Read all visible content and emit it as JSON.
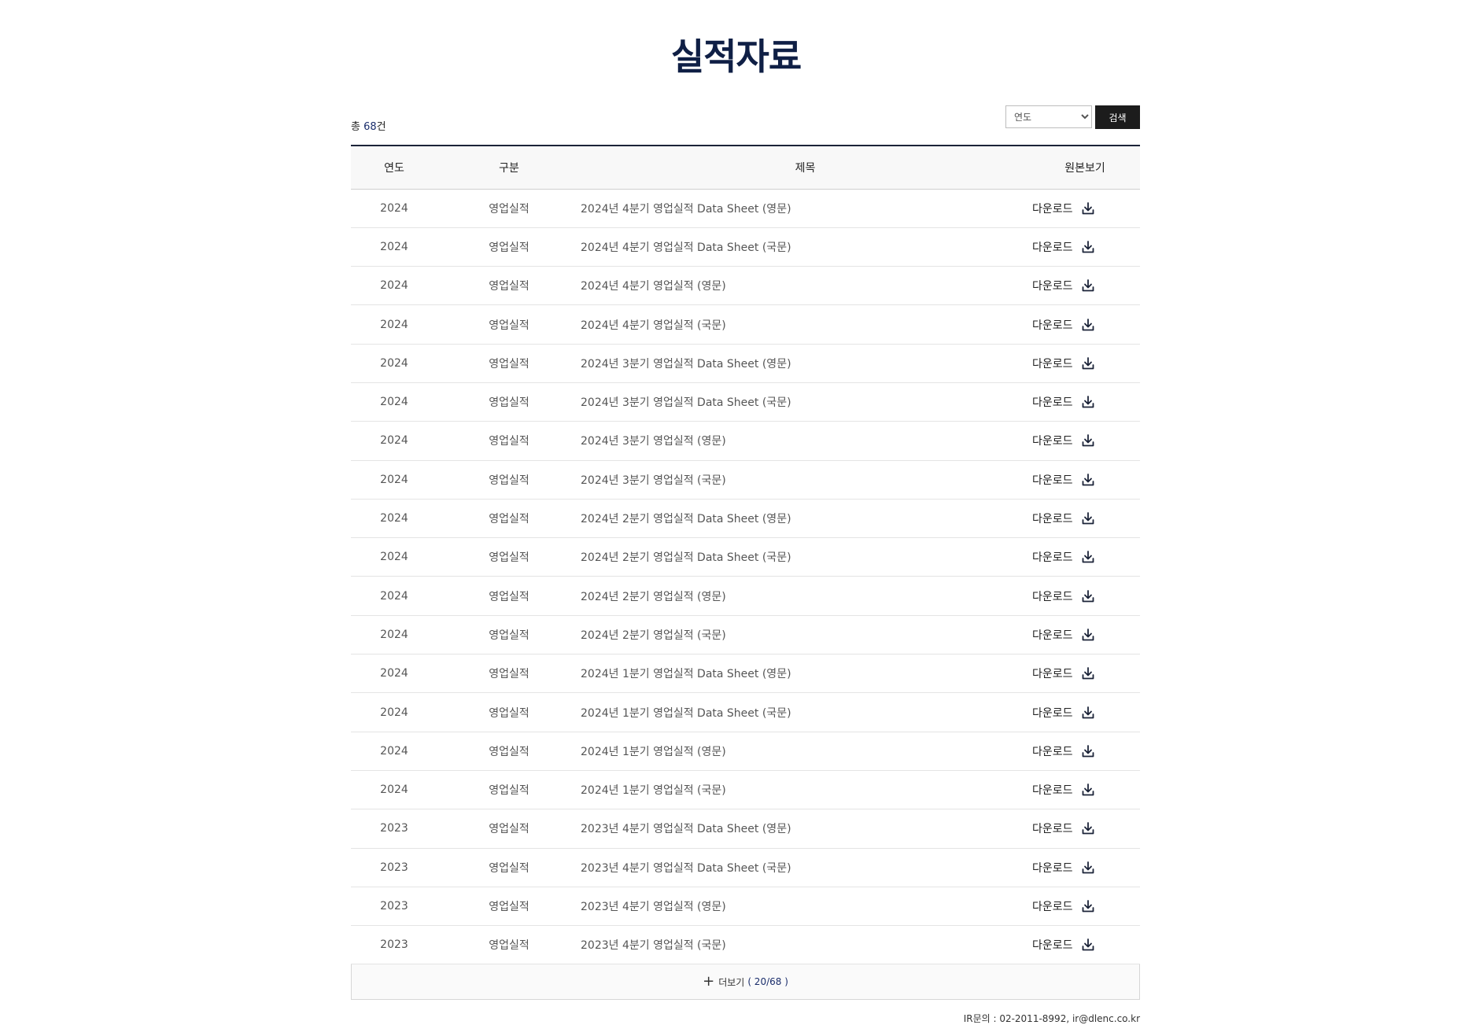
{
  "page": {
    "title": "실적자료"
  },
  "toolbar": {
    "total_prefix": "총 ",
    "total_count": "68",
    "total_suffix": "건",
    "year_select_value": "연도",
    "search_label": "검색"
  },
  "table": {
    "headers": {
      "year": "연도",
      "type": "구분",
      "title": "제목",
      "view": "원본보기"
    },
    "download_label": "다운로드",
    "rows": [
      {
        "year": "2024",
        "type": "영업실적",
        "title": "2024년 4분기 영업실적 Data Sheet (영문)"
      },
      {
        "year": "2024",
        "type": "영업실적",
        "title": "2024년 4분기 영업실적 Data Sheet (국문)"
      },
      {
        "year": "2024",
        "type": "영업실적",
        "title": "2024년 4분기 영업실적 (영문)"
      },
      {
        "year": "2024",
        "type": "영업실적",
        "title": "2024년 4분기 영업실적 (국문)"
      },
      {
        "year": "2024",
        "type": "영업실적",
        "title": "2024년 3분기 영업실적 Data Sheet (영문)"
      },
      {
        "year": "2024",
        "type": "영업실적",
        "title": "2024년 3분기 영업실적 Data Sheet (국문)"
      },
      {
        "year": "2024",
        "type": "영업실적",
        "title": "2024년 3분기 영업실적 (영문)"
      },
      {
        "year": "2024",
        "type": "영업실적",
        "title": "2024년 3분기 영업실적 (국문)"
      },
      {
        "year": "2024",
        "type": "영업실적",
        "title": "2024년 2분기 영업실적 Data Sheet (영문)"
      },
      {
        "year": "2024",
        "type": "영업실적",
        "title": "2024년 2분기 영업실적 Data Sheet (국문)"
      },
      {
        "year": "2024",
        "type": "영업실적",
        "title": "2024년 2분기 영업실적 (영문)"
      },
      {
        "year": "2024",
        "type": "영업실적",
        "title": "2024년 2분기 영업실적 (국문)"
      },
      {
        "year": "2024",
        "type": "영업실적",
        "title": "2024년 1분기 영업실적 Data Sheet (영문)"
      },
      {
        "year": "2024",
        "type": "영업실적",
        "title": "2024년 1분기 영업실적 Data Sheet (국문)"
      },
      {
        "year": "2024",
        "type": "영업실적",
        "title": "2024년 1분기 영업실적 (영문)"
      },
      {
        "year": "2024",
        "type": "영업실적",
        "title": "2024년 1분기 영업실적 (국문)"
      },
      {
        "year": "2023",
        "type": "영업실적",
        "title": "2023년 4분기 영업실적 Data Sheet (영문)"
      },
      {
        "year": "2023",
        "type": "영업실적",
        "title": "2023년 4분기 영업실적 Data Sheet (국문)"
      },
      {
        "year": "2023",
        "type": "영업실적",
        "title": "2023년 4분기 영업실적 (영문)"
      },
      {
        "year": "2023",
        "type": "영업실적",
        "title": "2023년 4분기 영업실적 (국문)"
      }
    ]
  },
  "more": {
    "label": "더보기",
    "count": "( 20/68 )"
  },
  "footer": {
    "contact": "IR문의 : 02-2011-8992, ir@dlenc.co.kr"
  }
}
